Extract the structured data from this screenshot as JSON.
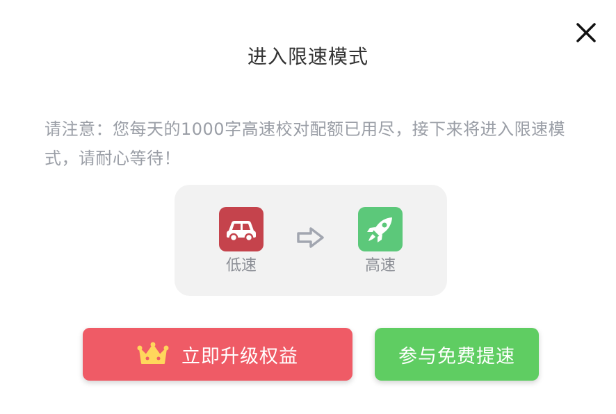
{
  "dialog": {
    "title": "进入限速模式",
    "notice": "请注意：您每天的1000字高速校对配额已用尽，接下来将进入限速模式，请耐心等待！",
    "close_icon": "close-icon"
  },
  "speed": {
    "slow": {
      "label": "低速",
      "icon": "car-icon",
      "color": "#c5434c"
    },
    "fast": {
      "label": "高速",
      "icon": "rocket-icon",
      "color": "#5cc87a"
    },
    "arrow_icon": "arrow-right-icon"
  },
  "buttons": {
    "upgrade": {
      "label": "立即升级权益",
      "icon": "crown-icon",
      "color": "#ef5b66"
    },
    "free": {
      "label": "参与免费提速",
      "color": "#5fcd62"
    }
  }
}
